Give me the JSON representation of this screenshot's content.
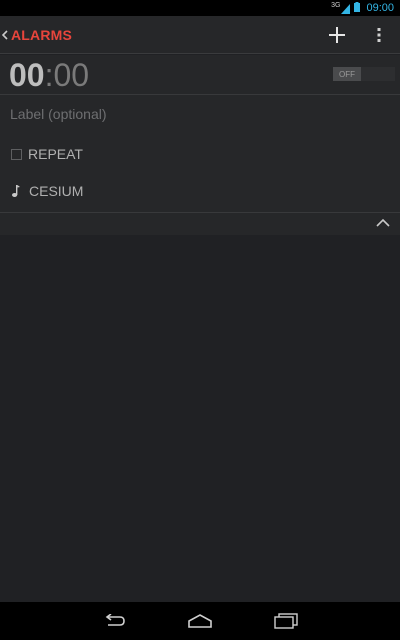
{
  "status_bar": {
    "network_type": "3G",
    "time": "09:00"
  },
  "action_bar": {
    "title": "ALARMS",
    "add_icon": "plus-icon",
    "overflow_icon": "overflow-menu-icon",
    "title_color": "#e8453c"
  },
  "alarm": {
    "hours": "00",
    "separator": ":",
    "minutes": "00",
    "toggle_state": "OFF",
    "label_placeholder": "Label (optional)",
    "repeat_label": "REPEAT",
    "repeat_checked": false,
    "ringtone": "CESIUM",
    "collapse_icon": "chevron-up-icon"
  },
  "nav_bar": {
    "back_icon": "back-icon",
    "home_icon": "home-icon",
    "recents_icon": "recents-icon"
  }
}
